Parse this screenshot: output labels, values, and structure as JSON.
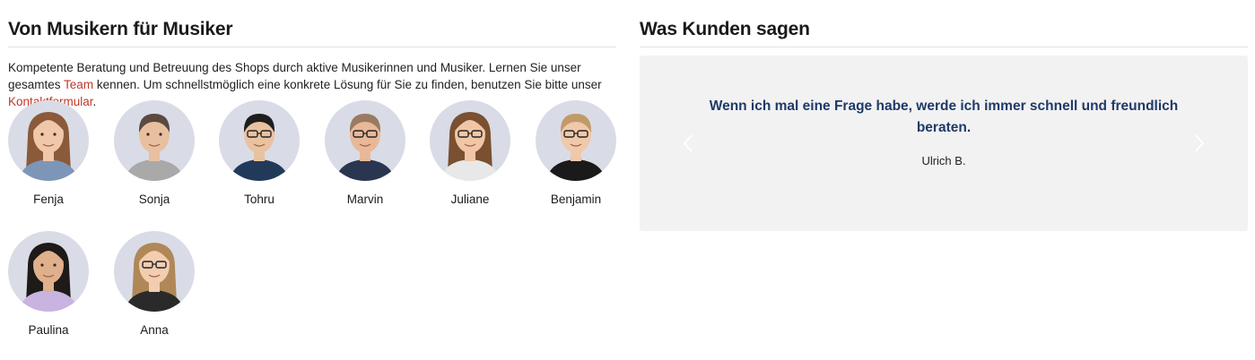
{
  "team_section": {
    "title": "Von Musikern für Musiker",
    "intro_part1": "Kompetente Beratung und Betreuung des Shops durch aktive Musikerinnen und Musiker. Lernen Sie unser gesamtes ",
    "team_link": "Team",
    "intro_part2": " kennen. Um schnellstmöglich eine konkrete Lösung für Sie zu finden, benutzen Sie bitte unser ",
    "contact_link": "Kontaktformular",
    "intro_part3": ".",
    "members": [
      {
        "name": "Fenja",
        "hair": "#8a5a3a",
        "shirt": "#7d96b8",
        "skin": "#f0c7a8",
        "long_hair": true,
        "glasses": false
      },
      {
        "name": "Sonja",
        "hair": "#5a4a40",
        "shirt": "#a9a9a9",
        "skin": "#e8c0a0",
        "long_hair": false,
        "glasses": false
      },
      {
        "name": "Tohru",
        "hair": "#1e1e1e",
        "shirt": "#223a5a",
        "skin": "#e9c2a0",
        "long_hair": false,
        "glasses": true
      },
      {
        "name": "Marvin",
        "hair": "#9a7a60",
        "shirt": "#2a3550",
        "skin": "#e8b898",
        "long_hair": false,
        "glasses": true
      },
      {
        "name": "Juliane",
        "hair": "#7a5030",
        "shirt": "#e8e8e8",
        "skin": "#f0c6a6",
        "long_hair": true,
        "glasses": true
      },
      {
        "name": "Benjamin",
        "hair": "#c29a68",
        "shirt": "#1a1a1a",
        "skin": "#f0c8aa",
        "long_hair": false,
        "glasses": true
      },
      {
        "name": "Paulina",
        "hair": "#1e1a18",
        "shirt": "#c9b3e0",
        "skin": "#dfb08c",
        "long_hair": true,
        "glasses": false
      },
      {
        "name": "Anna",
        "hair": "#b08858",
        "shirt": "#2a2a2a",
        "skin": "#f2cdb0",
        "long_hair": true,
        "glasses": true
      }
    ]
  },
  "testimonials": {
    "title": "Was Kunden sagen",
    "quote": "Wenn ich mal eine Frage habe, werde ich immer schnell und freundlich beraten.",
    "author": "Ulrich B.",
    "prev_icon": "chevron-left-icon",
    "next_icon": "chevron-right-icon"
  },
  "colors": {
    "link": "#c0392b",
    "quote": "#1f3a68",
    "avatar_bg": "#d9dce6",
    "box_bg": "#f2f2f2"
  }
}
